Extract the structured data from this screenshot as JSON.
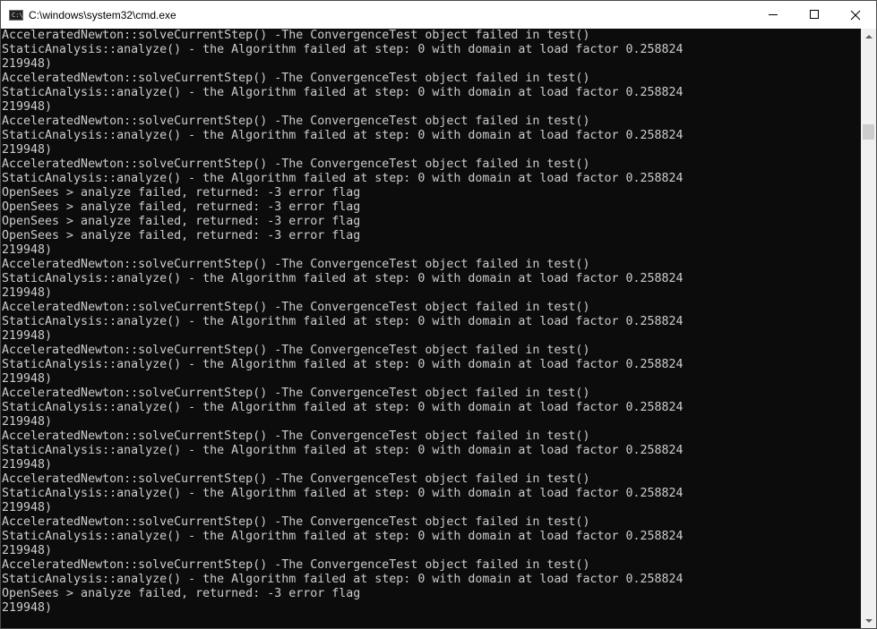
{
  "window": {
    "title": "C:\\windows\\system32\\cmd.exe",
    "icon": "cmd-icon",
    "controls": [
      "minimize-icon",
      "maximize-icon",
      "close-icon"
    ]
  },
  "console": {
    "lines": [
      "AcceleratedNewton::solveCurrentStep() -The ConvergenceTest object failed in test()",
      "StaticAnalysis::analyze() - the Algorithm failed at step: 0 with domain at load factor 0.258824",
      "219948)",
      "AcceleratedNewton::solveCurrentStep() -The ConvergenceTest object failed in test()",
      "StaticAnalysis::analyze() - the Algorithm failed at step: 0 with domain at load factor 0.258824",
      "219948)",
      "AcceleratedNewton::solveCurrentStep() -The ConvergenceTest object failed in test()",
      "StaticAnalysis::analyze() - the Algorithm failed at step: 0 with domain at load factor 0.258824",
      "219948)",
      "AcceleratedNewton::solveCurrentStep() -The ConvergenceTest object failed in test()",
      "StaticAnalysis::analyze() - the Algorithm failed at step: 0 with domain at load factor 0.258824",
      "OpenSees > analyze failed, returned: -3 error flag",
      "OpenSees > analyze failed, returned: -3 error flag",
      "OpenSees > analyze failed, returned: -3 error flag",
      "OpenSees > analyze failed, returned: -3 error flag",
      "219948)",
      "AcceleratedNewton::solveCurrentStep() -The ConvergenceTest object failed in test()",
      "StaticAnalysis::analyze() - the Algorithm failed at step: 0 with domain at load factor 0.258824",
      "219948)",
      "AcceleratedNewton::solveCurrentStep() -The ConvergenceTest object failed in test()",
      "StaticAnalysis::analyze() - the Algorithm failed at step: 0 with domain at load factor 0.258824",
      "219948)",
      "AcceleratedNewton::solveCurrentStep() -The ConvergenceTest object failed in test()",
      "StaticAnalysis::analyze() - the Algorithm failed at step: 0 with domain at load factor 0.258824",
      "219948)",
      "AcceleratedNewton::solveCurrentStep() -The ConvergenceTest object failed in test()",
      "StaticAnalysis::analyze() - the Algorithm failed at step: 0 with domain at load factor 0.258824",
      "219948)",
      "AcceleratedNewton::solveCurrentStep() -The ConvergenceTest object failed in test()",
      "StaticAnalysis::analyze() - the Algorithm failed at step: 0 with domain at load factor 0.258824",
      "219948)",
      "AcceleratedNewton::solveCurrentStep() -The ConvergenceTest object failed in test()",
      "StaticAnalysis::analyze() - the Algorithm failed at step: 0 with domain at load factor 0.258824",
      "219948)",
      "AcceleratedNewton::solveCurrentStep() -The ConvergenceTest object failed in test()",
      "StaticAnalysis::analyze() - the Algorithm failed at step: 0 with domain at load factor 0.258824",
      "219948)",
      "AcceleratedNewton::solveCurrentStep() -The ConvergenceTest object failed in test()",
      "StaticAnalysis::analyze() - the Algorithm failed at step: 0 with domain at load factor 0.258824",
      "OpenSees > analyze failed, returned: -3 error flag",
      "219948)"
    ]
  },
  "colors": {
    "console_background": "#0c0c0c",
    "console_text": "#cccccc",
    "titlebar_background": "#ffffff",
    "scrollbar_track": "#f0f0f0",
    "scrollbar_thumb": "#cdcdcd"
  }
}
